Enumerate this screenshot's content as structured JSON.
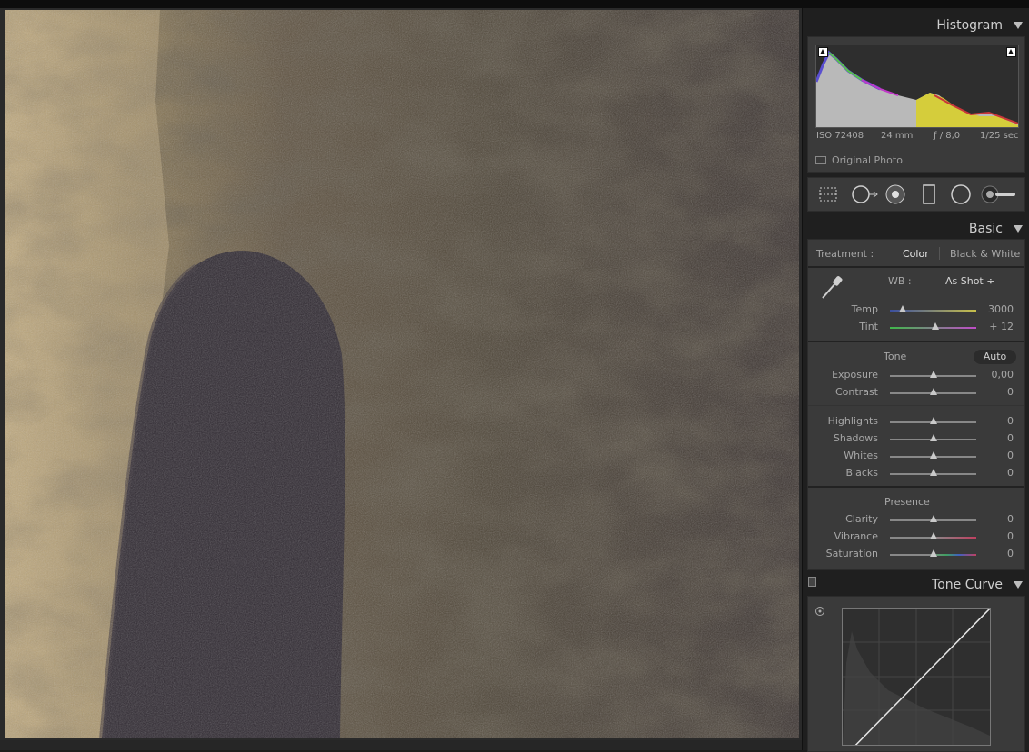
{
  "histogram": {
    "title": "Histogram",
    "iso": "ISO 72408",
    "focal_length": "24 mm",
    "aperture": "ƒ / 8,0",
    "shutter": "1/25 sec",
    "original_photo_label": "Original Photo"
  },
  "basic": {
    "title": "Basic",
    "treatment_label": "Treatment :",
    "treatment_color": "Color",
    "treatment_bw": "Black & White",
    "wb_label": "WB :",
    "wb_value": "As Shot ÷",
    "temp": {
      "label": "Temp",
      "value": "3000",
      "level": 0.15
    },
    "tint": {
      "label": "Tint",
      "value": "+ 12",
      "level": 0.53
    },
    "tone_label": "Tone",
    "auto_label": "Auto",
    "exposure": {
      "label": "Exposure",
      "value": "0,00",
      "level": 0.5
    },
    "contrast": {
      "label": "Contrast",
      "value": "0",
      "level": 0.5
    },
    "highlights": {
      "label": "Highlights",
      "value": "0",
      "level": 0.5
    },
    "shadows": {
      "label": "Shadows",
      "value": "0",
      "level": 0.5
    },
    "whites": {
      "label": "Whites",
      "value": "0",
      "level": 0.5
    },
    "blacks": {
      "label": "Blacks",
      "value": "0",
      "level": 0.5
    },
    "presence_label": "Presence",
    "clarity": {
      "label": "Clarity",
      "value": "0",
      "level": 0.5
    },
    "vibrance": {
      "label": "Vibrance",
      "value": "0",
      "level": 0.5
    },
    "saturation": {
      "label": "Saturation",
      "value": "0",
      "level": 0.5
    }
  },
  "tone_curve": {
    "title": "Tone Curve"
  },
  "icons": {
    "crop": "crop-overlay-icon",
    "spot": "spot-removal-icon",
    "redeye": "red-eye-icon",
    "graduated": "graduated-filter-icon",
    "radial": "radial-filter-icon",
    "brush": "adjustment-brush-icon",
    "eyedropper": "white-balance-selector-icon",
    "target": "targeted-adjustment-icon"
  },
  "colors": {
    "panel_bg": "#1f1f1f",
    "section_bg": "#3a3a3a",
    "accent_text": "#cfcfcf"
  }
}
